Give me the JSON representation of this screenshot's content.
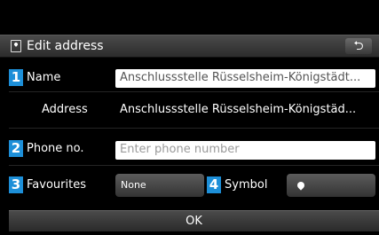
{
  "header": {
    "title": "Edit address",
    "back_glyph": "⮌"
  },
  "rows": {
    "name": {
      "badge": "1",
      "label": "Name",
      "value": "Anschlussstelle Rüsselsheim-Königstädt..."
    },
    "address": {
      "label": "Address",
      "value": "Anschlussstelle Rüsselsheim-Königstäd..."
    },
    "phone": {
      "badge": "2",
      "label": "Phone no.",
      "placeholder": "Enter phone number"
    },
    "favourites": {
      "badge": "3",
      "label": "Favourites",
      "value": "None"
    },
    "symbol": {
      "badge": "4",
      "label": "Symbol",
      "icon": "location-pin-icon"
    }
  },
  "ok_label": "OK",
  "colors": {
    "badge": "#1d8fd8",
    "background": "#000000"
  }
}
